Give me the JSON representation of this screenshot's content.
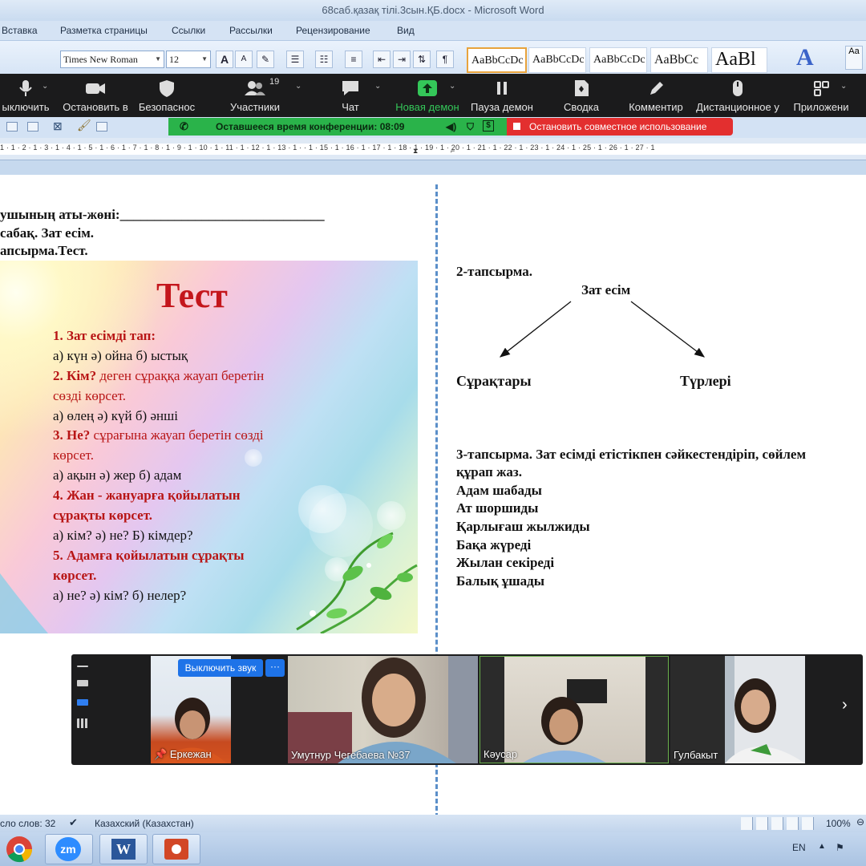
{
  "window": {
    "title": "68саб.қазақ тілі.3сын.ҚБ.docx - Microsoft Word"
  },
  "ribbon": {
    "tabs": [
      "Вставка",
      "Разметка страницы",
      "Ссылки",
      "Рассылки",
      "Рецензирование",
      "Вид"
    ],
    "font_name": "Times New Roman",
    "font_size": "12",
    "grow_font": "A",
    "shrink_font": "A",
    "para_mark": "¶",
    "styles": [
      "AaBbCcDc",
      "AaBbCcDc",
      "AaBbCcDc",
      "AaBbCc",
      "AaBl"
    ],
    "change_styles": "A"
  },
  "zoom_toolbar": {
    "items": [
      {
        "label": "ыключить"
      },
      {
        "label": "Остановить в"
      },
      {
        "label": "Безопаснос"
      },
      {
        "label": "Участники",
        "count": "19"
      },
      {
        "label": "Чат"
      },
      {
        "label": "Новая демон"
      },
      {
        "label": "Пауза демон"
      },
      {
        "label": "Сводка"
      },
      {
        "label": "Комментир"
      },
      {
        "label": "Дистанционное у"
      },
      {
        "label": "Приложени"
      }
    ]
  },
  "share_bar": {
    "time_left": "Оставшееся время конференции: 08:09",
    "stop_share": "Остановить совместное использование"
  },
  "ruler": {
    "marks": "1 · 1 · 2 · 1 · 3 · 1 · 4 · 1 · 5 · 1 · 6 · 1 · 7 · 1 · 8 · 1 · 9 · 1 · 10 · 1 · 11 · 1 · 12 · 1 · 13 · 1 ·     · 1 · 15 · 1 · 16 · 1 · 17 · 1 · 18 · 1 · 19 · 1 · 20 · 1 · 21 · 1 · 22 · 1 · 23 · 1 · 24 · 1 · 25 · 1 · 26 · 1 · 27 · 1"
  },
  "document": {
    "left": {
      "line1": "ушының аты-жөні:______________________________",
      "line2": "сабақ. Зат есім.",
      "line3": "апсырма.Тест."
    },
    "slide": {
      "title": "Тест",
      "lines": [
        {
          "kind": "q",
          "text": "1. Зат есімді тап:"
        },
        {
          "kind": "a",
          "text": "а) күн   ә) ойна   б) ыстық"
        },
        {
          "kind": "q",
          "bold": "2. Кім?",
          "rest": " деген сұраққа жауап беретін"
        },
        {
          "kind": "qn",
          "text": "сөзді көрсет."
        },
        {
          "kind": "a",
          "text": "а) өлең    ә)   күй   б) әнші"
        },
        {
          "kind": "q",
          "bold": "3. Не?",
          "rest": " сұрағына жауап беретін сөзді"
        },
        {
          "kind": "qn",
          "text": "көрсет."
        },
        {
          "kind": "a",
          "text": "а) ақын   ә) жер   б) адам"
        },
        {
          "kind": "q",
          "text": "4. Жан - жануарға қойылатын"
        },
        {
          "kind": "q",
          "text": "сұрақты көрсет."
        },
        {
          "kind": "a",
          "text": "а) кім?  ә) не?  Б) кімдер?"
        },
        {
          "kind": "q",
          "text": "5. Адамға қойылатын сұрақты"
        },
        {
          "kind": "q",
          "text": "көрсет."
        },
        {
          "kind": "a",
          "text": "а) не?   ә) кім?  б) нелер?"
        }
      ]
    },
    "right": {
      "task2": "2-тапсырма.",
      "center": "Зат есім",
      "branch_left": "Сұрақтары",
      "branch_right": "Түрлері",
      "task3_line1": "3-тапсырма. Зат есімді етістікпен  сәйкестендіріп, сөйлем",
      "task3_line2": "құрап жаз.",
      "pairs": [
        "Адам шабады",
        "Ат шоршиды",
        "Қарлығаш жылжиды",
        "Бақа жүреді",
        "Жылан секіреді",
        "Балық ұшады"
      ]
    }
  },
  "video_strip": {
    "mute_button": "Выключить звук",
    "more_button": "···",
    "participants": [
      "Еркежан",
      "Умутнур Чегебаева №37",
      "Кәусар",
      "Гулбакыт"
    ]
  },
  "status_bar": {
    "word_count": "сло слов: 32",
    "language": "Казахский (Казахстан)",
    "zoom": "100%"
  },
  "taskbar": {
    "apps": [
      "chrome",
      "zm",
      "word",
      "powerpoint"
    ],
    "zoom_app_label": "zm",
    "lang": "EN"
  },
  "colors": {
    "zoom_bg": "#1b1b1c",
    "share_green": "#2ab34a",
    "stop_red": "#e32f2f",
    "slide_title": "#c4161c",
    "question_red": "#b81515",
    "divider_blue": "#5b8fc9"
  }
}
